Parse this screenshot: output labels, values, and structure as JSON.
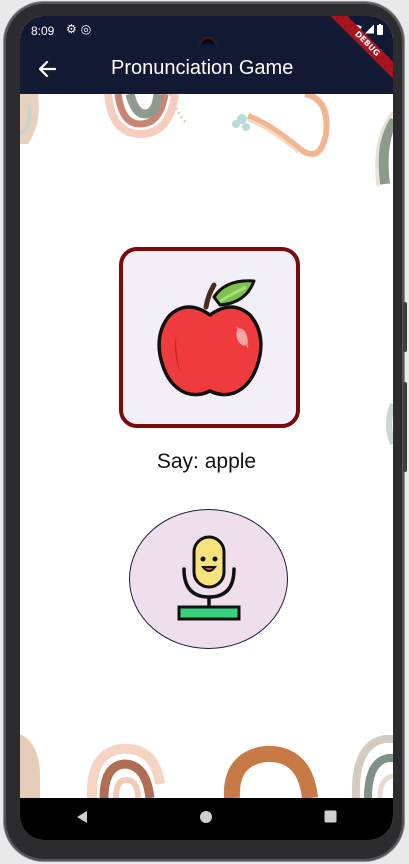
{
  "status_bar": {
    "time": "8:09",
    "left_icons": [
      "gear-icon",
      "at-sign-icon"
    ],
    "right_icons": [
      "wifi-icon",
      "signal-icon",
      "battery-icon"
    ]
  },
  "app_bar": {
    "title": "Pronunciation Game",
    "back_icon": "arrow-left-icon",
    "background_color": "#121933"
  },
  "debug_banner": {
    "label": "DEBUG",
    "color": "#a8141e"
  },
  "game": {
    "image_icon": "apple-icon",
    "prompt": "Say: apple",
    "mic_icon": "microphone-icon",
    "card_border_color": "#7c0a0b",
    "card_background": "#f3eff8",
    "mic_background": "#efdfec"
  },
  "nav_bar": {
    "buttons": [
      "back-triangle-icon",
      "home-circle-icon",
      "recents-square-icon"
    ]
  }
}
